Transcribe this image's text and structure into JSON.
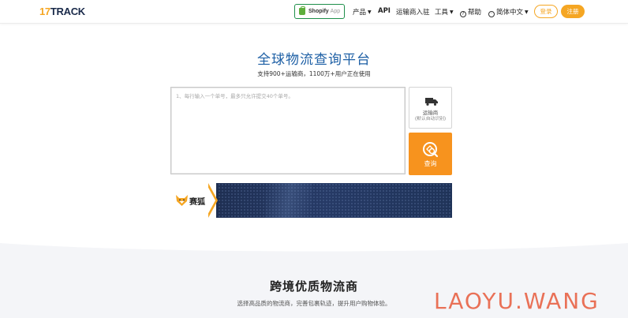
{
  "header": {
    "logo_num": "17",
    "logo_text": "TRACK",
    "shopify": {
      "label": "Shopify",
      "suffix": "App"
    },
    "nav": {
      "products": "产品",
      "api": "API",
      "carrier_join": "运输商入驻",
      "tools": "工具",
      "help": "帮助",
      "language": "简体中文"
    },
    "login": "登录",
    "register": "注册"
  },
  "hero": {
    "title": "全球物流查询平台",
    "subtitle": "支持900+运输商，1100万+用户正在使用"
  },
  "tracking": {
    "placeholder": "1、每行输入一个单号，最多只允许提交40个单号。",
    "value": ""
  },
  "carrier_button": {
    "label": "运输商",
    "sublabel": "(默认自动识别)",
    "icon": "truck-icon"
  },
  "search_button": {
    "label": "查询",
    "icon": "search-icon"
  },
  "banner": {
    "brand": "赛狐",
    "icon": "fox-icon"
  },
  "section": {
    "title": "跨境优质物流商",
    "subtitle": "选择高品质的物流商，完善包裹轨迹，提升用户购物体验。"
  },
  "watermark": "LAOYU.WANG",
  "colors": {
    "accent": "#f5a623",
    "search_orange": "#f7931e",
    "title_blue": "#1d5fa5",
    "shopify_green": "#1e8f4a",
    "watermark_red": "#e85a3c"
  }
}
